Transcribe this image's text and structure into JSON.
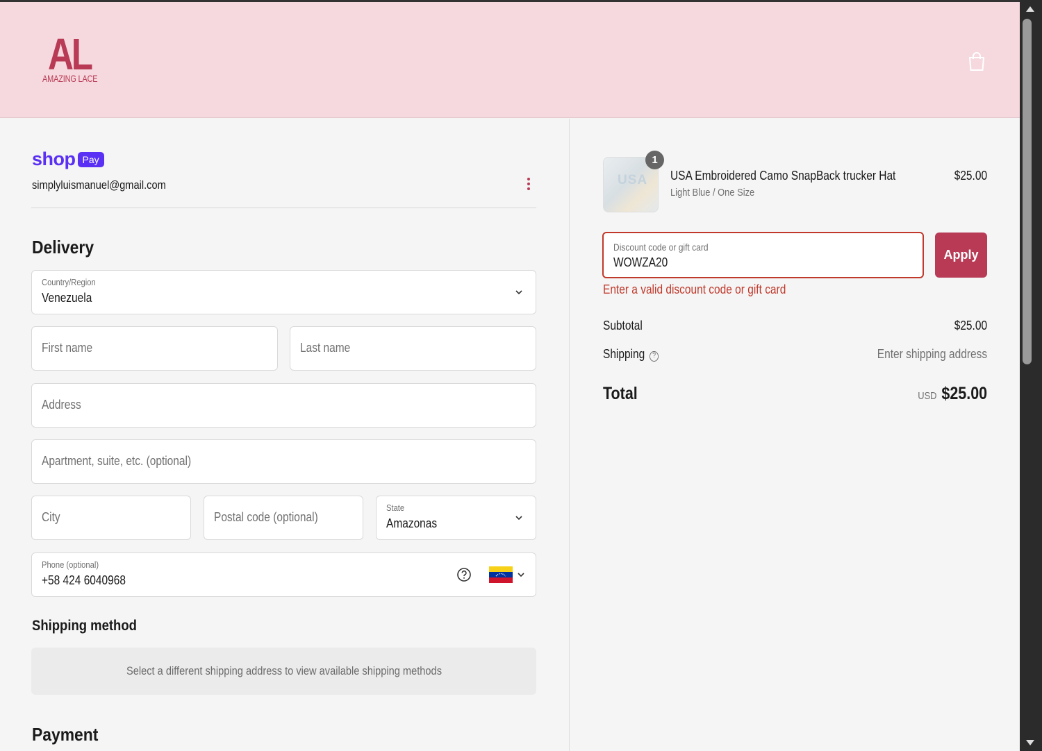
{
  "header": {
    "logo_letters": "AL",
    "logo_text": "AMAZING LACE",
    "cart_icon": "shopping-bag-icon"
  },
  "colors": {
    "brand": "#b83a55",
    "header_bg": "#f6d9de",
    "shop_pay": "#5a31f4",
    "error": "#c0392b"
  },
  "account": {
    "shop_label": "shop",
    "pay_label": "Pay",
    "email": "simplyluismanuel@gmail.com",
    "menu_icon": "more-vertical-icon"
  },
  "delivery": {
    "heading": "Delivery",
    "country": {
      "label": "Country/Region",
      "value": "Venezuela"
    },
    "first_name": {
      "placeholder": "First name"
    },
    "last_name": {
      "placeholder": "Last name"
    },
    "address": {
      "placeholder": "Address"
    },
    "apartment": {
      "placeholder": "Apartment, suite, etc. (optional)"
    },
    "city": {
      "placeholder": "City"
    },
    "postal": {
      "placeholder": "Postal code (optional)"
    },
    "state": {
      "label": "State",
      "value": "Amazonas"
    },
    "phone": {
      "label": "Phone (optional)",
      "value": "+58 424 6040968",
      "help_icon": "question-circle-icon",
      "flag_icon": "venezuela-flag-icon"
    }
  },
  "shipping_method": {
    "heading": "Shipping method",
    "message": "Select a different shipping address to view available shipping methods"
  },
  "payment": {
    "heading": "Payment"
  },
  "summary": {
    "product": {
      "quantity": "1",
      "name": "USA Embroidered Camo SnapBack trucker Hat",
      "variant": "Light Blue / One Size",
      "price": "$25.00",
      "image_text": "USA"
    },
    "discount": {
      "label": "Discount code or gift card",
      "value": "WOWZA20",
      "apply_label": "Apply",
      "error": "Enter a valid discount code or gift card"
    },
    "subtotal_label": "Subtotal",
    "subtotal_value": "$25.00",
    "shipping_label": "Shipping",
    "shipping_help": "?",
    "shipping_value": "Enter shipping address",
    "total_label": "Total",
    "total_currency": "USD",
    "total_value": "$25.00"
  }
}
